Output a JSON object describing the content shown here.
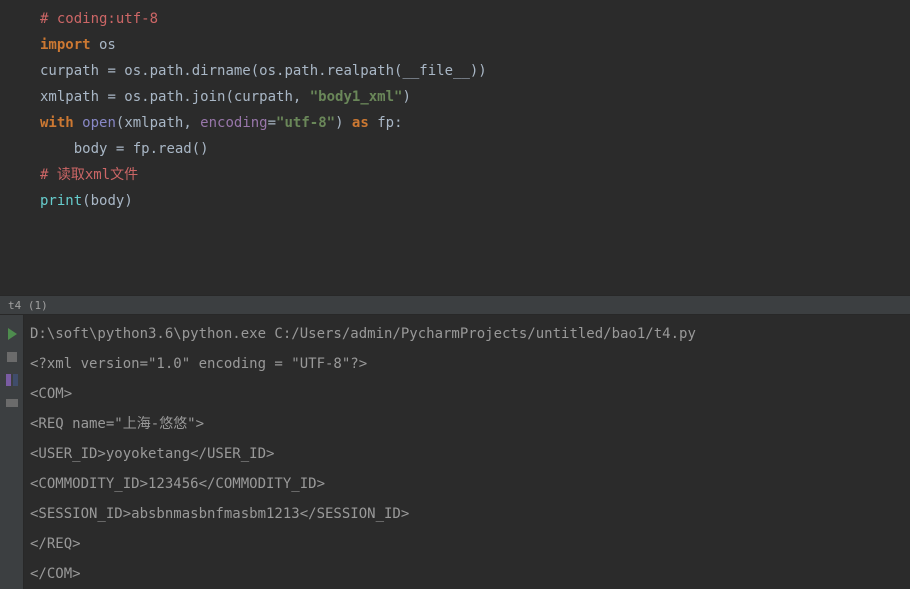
{
  "tab": {
    "label": "t4 (1)"
  },
  "code": {
    "l1": {
      "comment": "# coding:utf-8"
    },
    "l2": {
      "kw_import": "import",
      "mod": " os"
    },
    "l3": {
      "blank": ""
    },
    "l4": {
      "var": "curpath ",
      "op": "=",
      "call": " os.path.dirname(os.path.realpath(__file__))"
    },
    "l5": {
      "var": "xmlpath ",
      "op": "=",
      "call_a": " os.path.join(curpath, ",
      "str": "\"body1_xml\"",
      "call_b": ")"
    },
    "l6": {
      "blank": ""
    },
    "l7": {
      "kw_with": "with",
      "sp1": " ",
      "fn_open": "open",
      "paren_o": "(",
      "arg1": "xmlpath, ",
      "kwarg": "encoding",
      "eq": "=",
      "str": "\"utf-8\"",
      "paren_c": ") ",
      "kw_as": "as",
      "sp2": " fp:"
    },
    "l8": {
      "indent": "    body ",
      "op": "=",
      "call": " fp.read()"
    },
    "l9": {
      "blank": ""
    },
    "l10": {
      "comment": "# 读取xml文件"
    },
    "l11": {
      "fn": "print",
      "paren_o": "(",
      "arg": "body",
      "paren_c": ")"
    }
  },
  "console": {
    "l1": "D:\\soft\\python3.6\\python.exe C:/Users/admin/PycharmProjects/untitled/bao1/t4.py",
    "l2": "<?xml version=\"1.0\" encoding = \"UTF-8\"?>",
    "l3": "<COM>",
    "l4": "<REQ name=\"上海-悠悠\">",
    "l5": "<USER_ID>yoyoketang</USER_ID>",
    "l6": "<COMMODITY_ID>123456</COMMODITY_ID>",
    "l7": "<SESSION_ID>absbnmasbnfmasbm1213</SESSION_ID>",
    "l8": "</REQ>",
    "l9": "</COM>"
  }
}
